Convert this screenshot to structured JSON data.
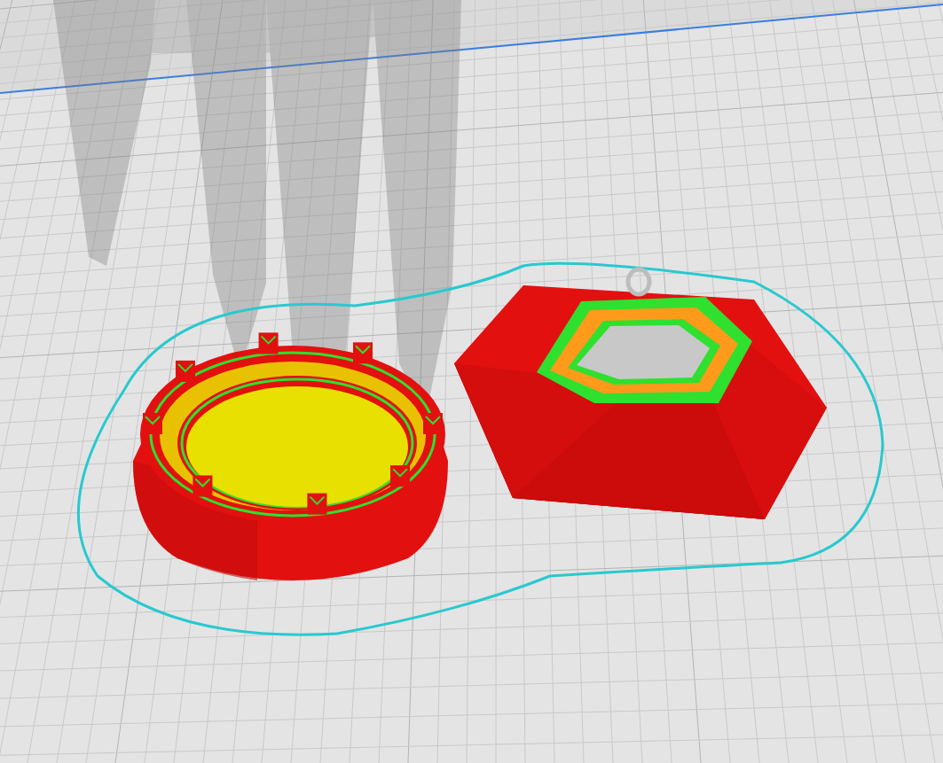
{
  "viewport": {
    "view": "layer-preview"
  },
  "line_types": [
    {
      "kind": "outer-wall",
      "color": "#e31010"
    },
    {
      "kind": "inner-wall",
      "color": "#2fe02f"
    },
    {
      "kind": "skin",
      "color": "#e8e000"
    },
    {
      "kind": "top-skin",
      "color": "#ff9a1a"
    },
    {
      "kind": "skirt",
      "color": "#29c9cf"
    },
    {
      "kind": "bed-edge",
      "color": "#3a7fe0"
    }
  ],
  "models": [
    {
      "kind": "round-base"
    },
    {
      "kind": "hex-cap"
    }
  ]
}
